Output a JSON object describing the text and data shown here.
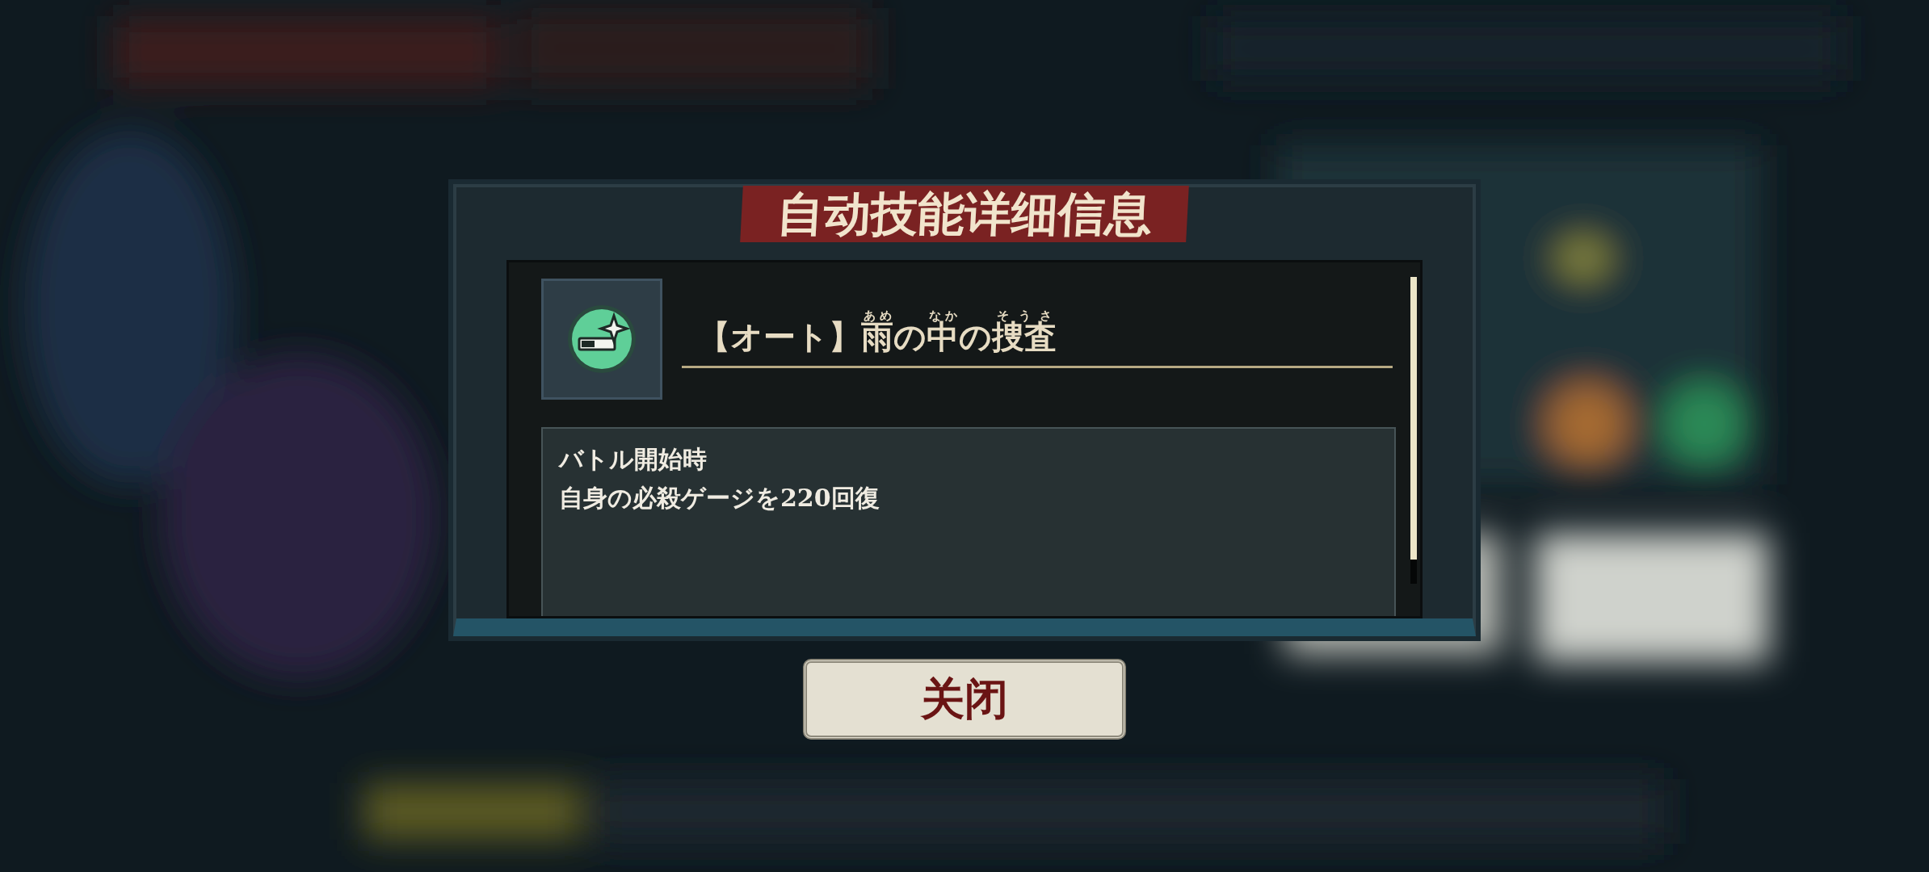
{
  "dialog": {
    "title": "自动技能详细信息",
    "skill": {
      "prefix": "【オート】",
      "name_parts": [
        {
          "text": "雨",
          "ruby": "あめ"
        },
        {
          "text": "の"
        },
        {
          "text": "中",
          "ruby": "なか"
        },
        {
          "text": "の"
        },
        {
          "text": "捜査",
          "ruby": "そうさ"
        }
      ],
      "description": [
        "バトル開始時",
        "自身の必殺ゲージを220回復"
      ]
    },
    "close_button": "关闭"
  }
}
